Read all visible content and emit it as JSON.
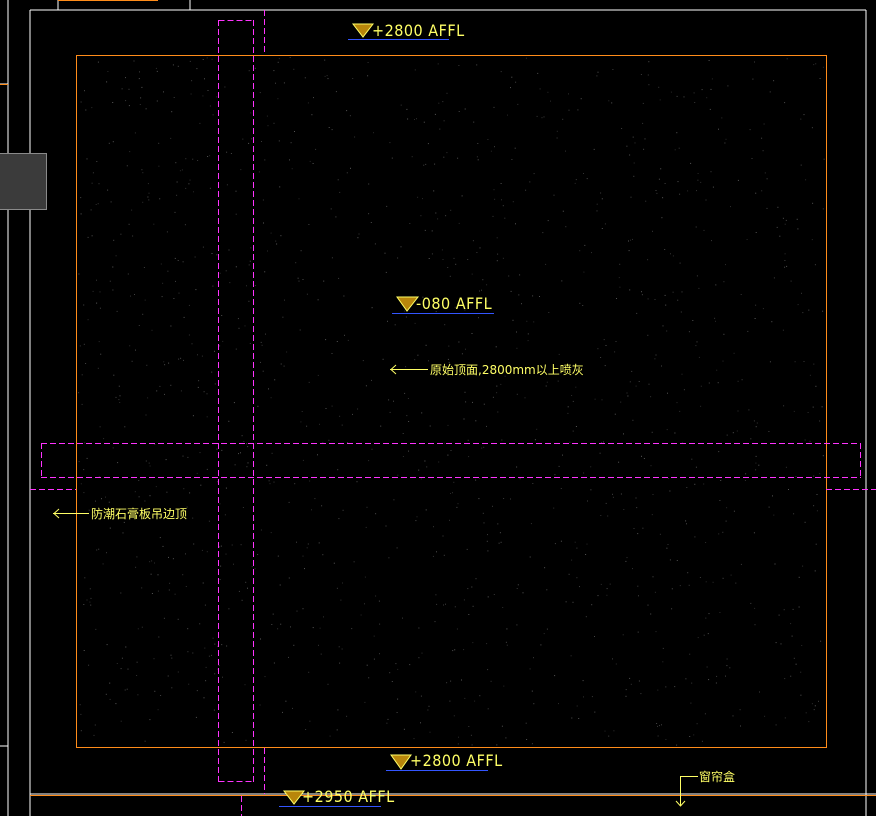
{
  "drawing": {
    "colors": {
      "background": "#000000",
      "ceiling_outline": "#ff8c1a",
      "hidden_line": "#ff33ff",
      "wall_line": "#ffffff",
      "label_text": "#ffff66",
      "level_marker_fill": "#b8860b",
      "level_underline": "#3355ff"
    },
    "level_markers": [
      {
        "id": "top",
        "label": "+2800 AFFL"
      },
      {
        "id": "center",
        "label": "-080 AFFL"
      },
      {
        "id": "bottom",
        "label": "+2800 AFFL"
      },
      {
        "id": "lower",
        "label": "+2950 AFFL"
      }
    ],
    "annotations": {
      "original_ceiling": "原始顶面,2800mm以上喷灰",
      "gypsum_edge": "防潮石膏板吊边顶",
      "curtain_box": "窗帘盒"
    },
    "icons": {
      "level": "level-triangle-icon",
      "leader": "arrow-left-icon",
      "curtain": "arrow-down-icon"
    }
  }
}
